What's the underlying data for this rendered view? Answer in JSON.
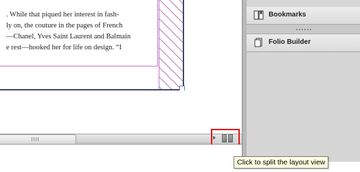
{
  "document": {
    "lines": [
      ". While that piqued her interest in fash-",
      "ly on, the couture in the pages of French",
      "—Chanel, Yves Saint Laurent and Balmain",
      "e rest—hooked her for life on design. “I"
    ]
  },
  "panel": {
    "items": [
      {
        "label": "Bookmarks",
        "icon": "bookmarks-icon"
      },
      {
        "label": "Folio Builder",
        "icon": "folio-builder-icon"
      }
    ]
  },
  "tooltip": {
    "text": "Click to split the layout view"
  },
  "colors": {
    "frame_edge": "#3e4a6b",
    "text_frame": "#c07ac8",
    "hatch": "#9b4fa3",
    "highlight": "#e0161b",
    "tooltip_bg": "#ffffe1",
    "panel_bg": "#d6d6d6"
  }
}
